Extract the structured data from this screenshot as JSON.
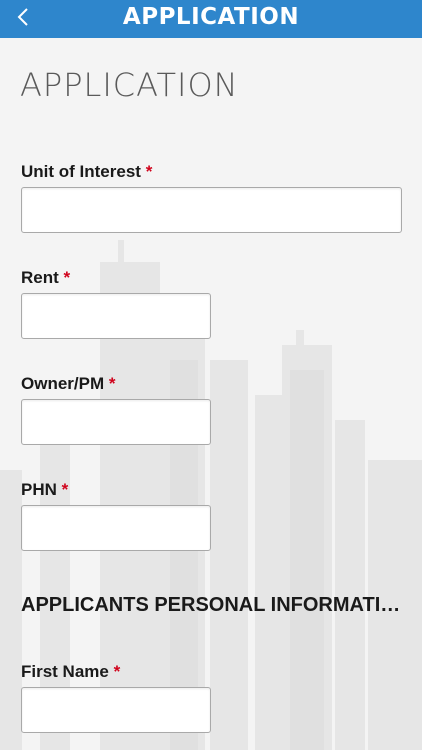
{
  "header": {
    "title": "APPLICATION",
    "back_icon": "chevron-left-icon"
  },
  "page": {
    "title": "APPLICATION"
  },
  "form": {
    "unit_of_interest": {
      "label": "Unit of Interest",
      "required_mark": "*",
      "value": ""
    },
    "rent": {
      "label": "Rent",
      "required_mark": "*",
      "value": ""
    },
    "owner_pm": {
      "label": "Owner/PM",
      "required_mark": "*",
      "value": ""
    },
    "phn": {
      "label": "PHN",
      "required_mark": "*",
      "value": ""
    },
    "section_heading": "APPLICANTS PERSONAL INFORMATION",
    "first_name": {
      "label": "First Name",
      "required_mark": "*",
      "value": ""
    }
  },
  "colors": {
    "header_bg": "#2e86cc",
    "required": "#d0021b",
    "background": "#f4f4f4"
  }
}
